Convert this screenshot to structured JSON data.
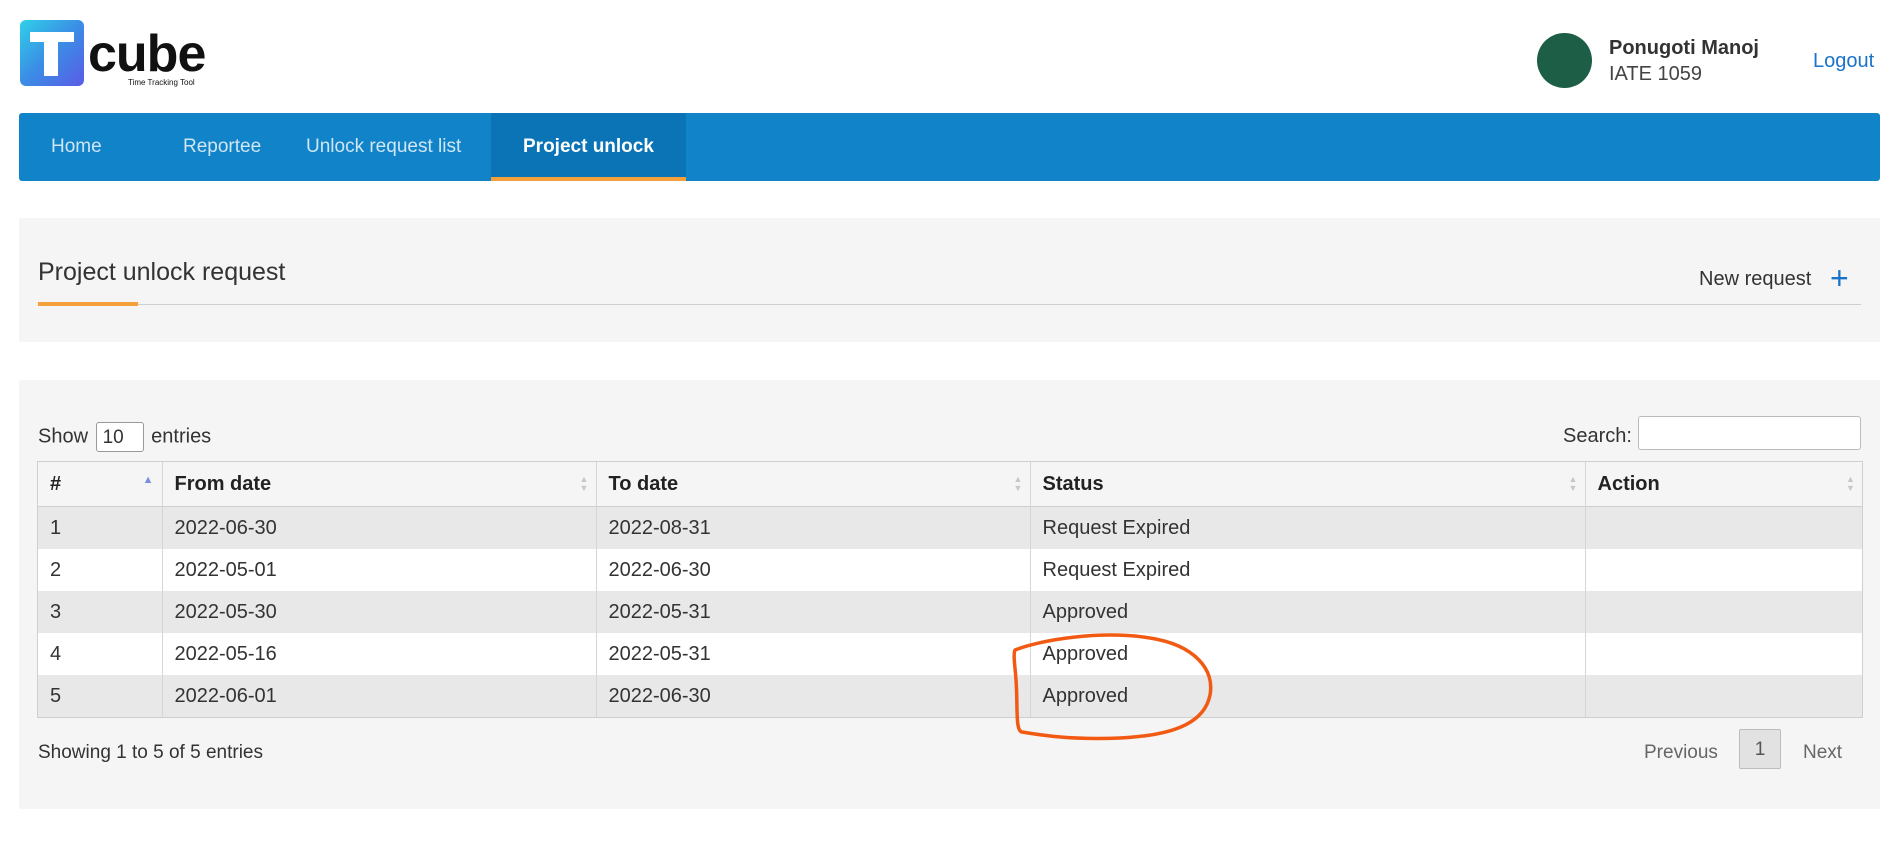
{
  "logo": {
    "word": "cube",
    "tagline": "Time Tracking Tool"
  },
  "user": {
    "name": "Ponugoti Manoj",
    "id": "IATE 1059",
    "logout_label": "Logout"
  },
  "nav": {
    "items": [
      {
        "label": "Home"
      },
      {
        "label": "Reportee"
      },
      {
        "label": "Unlock request list"
      },
      {
        "label": "Project unlock"
      }
    ]
  },
  "panel": {
    "title": "Project unlock request",
    "new_request_label": "New request"
  },
  "table_controls": {
    "show_label": "Show",
    "entries_label": "entries",
    "page_length": "10",
    "search_label": "Search:"
  },
  "table": {
    "headers": [
      "#",
      "From date",
      "To date",
      "Status",
      "Action"
    ],
    "rows": [
      {
        "num": "1",
        "from": "2022-06-30",
        "to": "2022-08-31",
        "status": "Request Expired",
        "action": ""
      },
      {
        "num": "2",
        "from": "2022-05-01",
        "to": "2022-06-30",
        "status": "Request Expired",
        "action": ""
      },
      {
        "num": "3",
        "from": "2022-05-30",
        "to": "2022-05-31",
        "status": "Approved",
        "action": ""
      },
      {
        "num": "4",
        "from": "2022-05-16",
        "to": "2022-05-31",
        "status": "Approved",
        "action": ""
      },
      {
        "num": "5",
        "from": "2022-06-01",
        "to": "2022-06-30",
        "status": "Approved",
        "action": ""
      }
    ]
  },
  "footer": {
    "info": "Showing 1 to 5 of 5 entries",
    "previous": "Previous",
    "page": "1",
    "next": "Next"
  },
  "colors": {
    "nav": "#1183c8",
    "accent": "#f5a03a",
    "link": "#1a73c9",
    "annotation": "#f25a14"
  }
}
